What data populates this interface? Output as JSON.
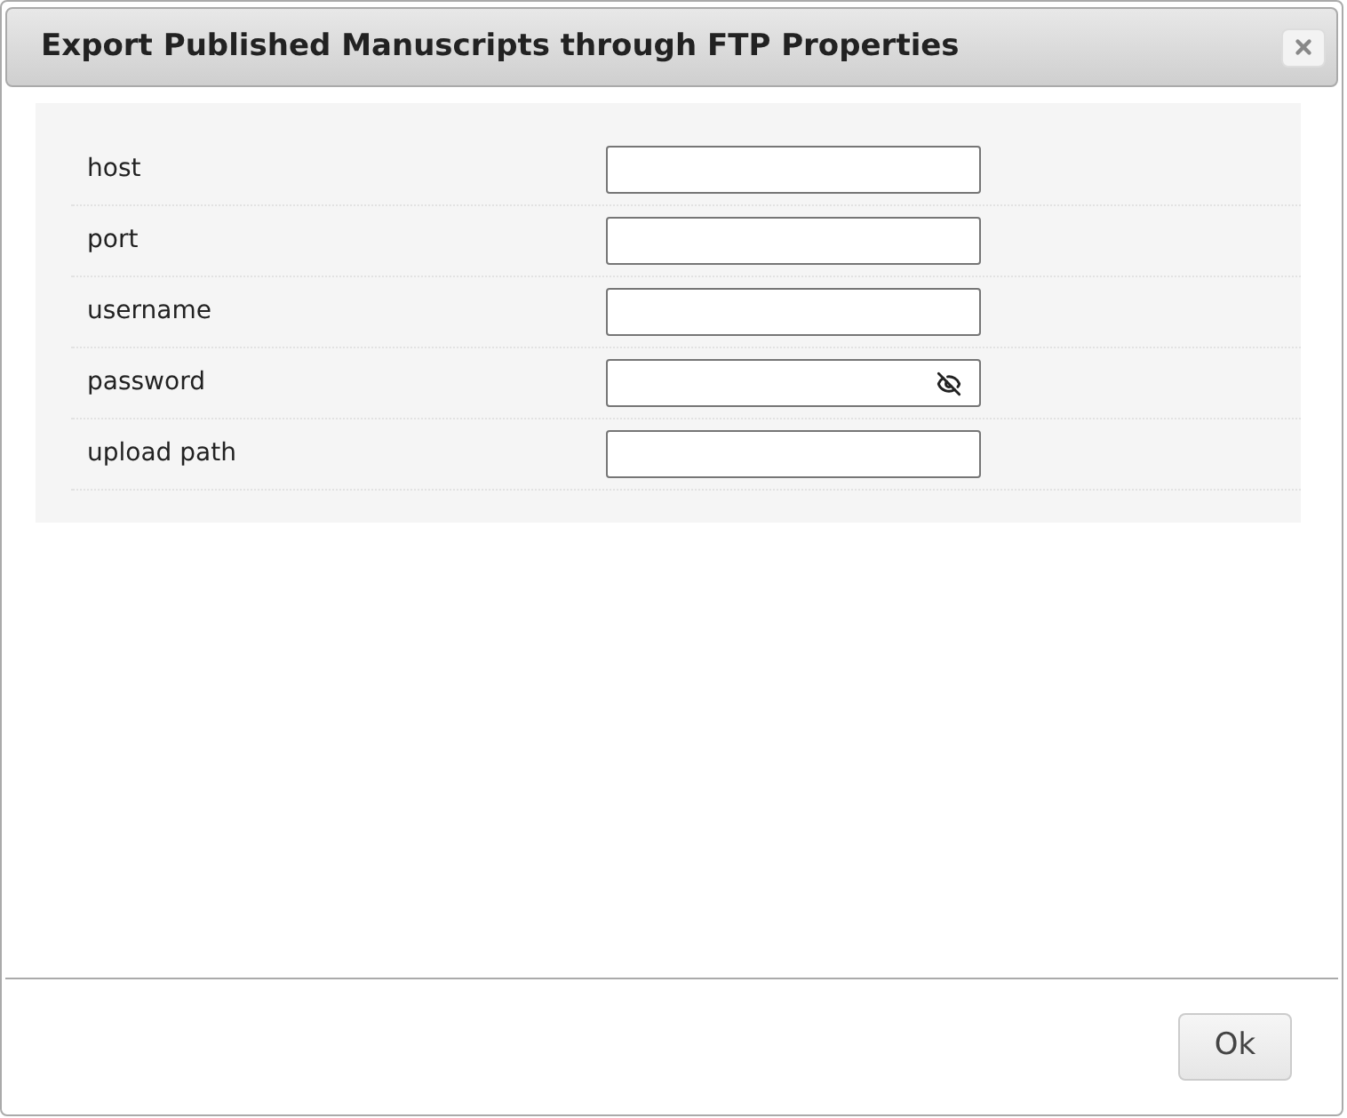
{
  "dialog": {
    "title": "Export Published Manuscripts through FTP Properties"
  },
  "fields": [
    {
      "label": "host",
      "kind": "text"
    },
    {
      "label": "port",
      "kind": "text"
    },
    {
      "label": "username",
      "kind": "text"
    },
    {
      "label": "password",
      "kind": "password"
    },
    {
      "label": "upload path",
      "kind": "text"
    }
  ],
  "buttons": [
    "Ok"
  ]
}
